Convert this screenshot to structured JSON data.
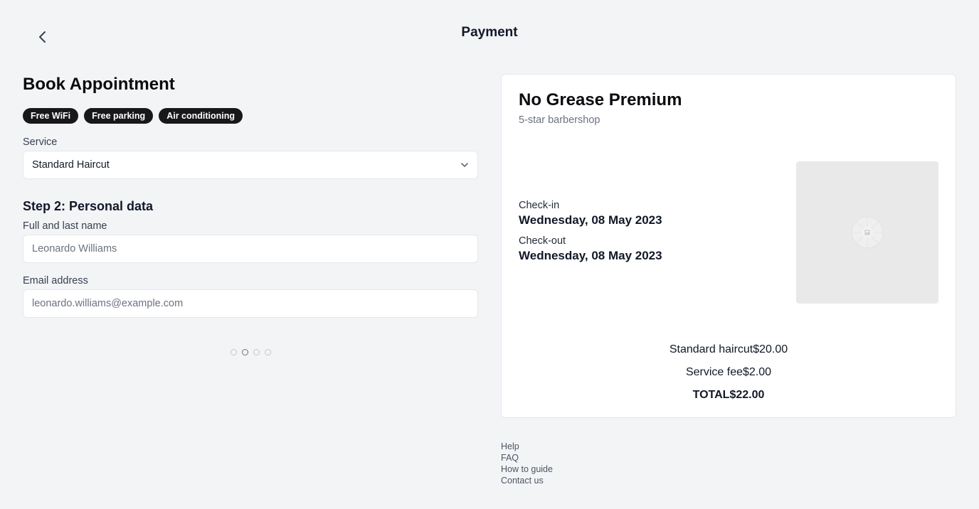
{
  "header": {
    "title": "Payment",
    "back_icon": "chevron-left-icon"
  },
  "booking": {
    "title": "Book Appointment",
    "amenities": [
      "Free WiFi",
      "Free parking",
      "Air conditioning"
    ],
    "service": {
      "label": "Service",
      "value": "Standard Haircut",
      "icon": "chevron-down-icon"
    },
    "step_title": "Step 2: Personal data",
    "name_field": {
      "label": "Full and last name",
      "placeholder": "Leonardo Williams"
    },
    "email_field": {
      "label": "Email address",
      "placeholder": "leonardo.williams@example.com"
    },
    "pagination": {
      "total": 4,
      "active_index": 1
    }
  },
  "summary_card": {
    "shop_name": "No Grease Premium",
    "shop_subtitle": "5-star barbershop",
    "checkin": {
      "label": "Check-in",
      "value": "Wednesday, 08 May 2023"
    },
    "checkout": {
      "label": "Check-out",
      "value": "Wednesday, 08 May 2023"
    },
    "image_icon": "image-placeholder-icon",
    "lines": [
      {
        "label": "Standard haircut",
        "amount": "$20.00"
      },
      {
        "label": "Service fee",
        "amount": "$2.00"
      }
    ],
    "total": {
      "label": "TOTAL",
      "amount": "$22.00"
    }
  },
  "footer": {
    "links": [
      "Help",
      "FAQ",
      "How to guide",
      "Contact us"
    ]
  }
}
